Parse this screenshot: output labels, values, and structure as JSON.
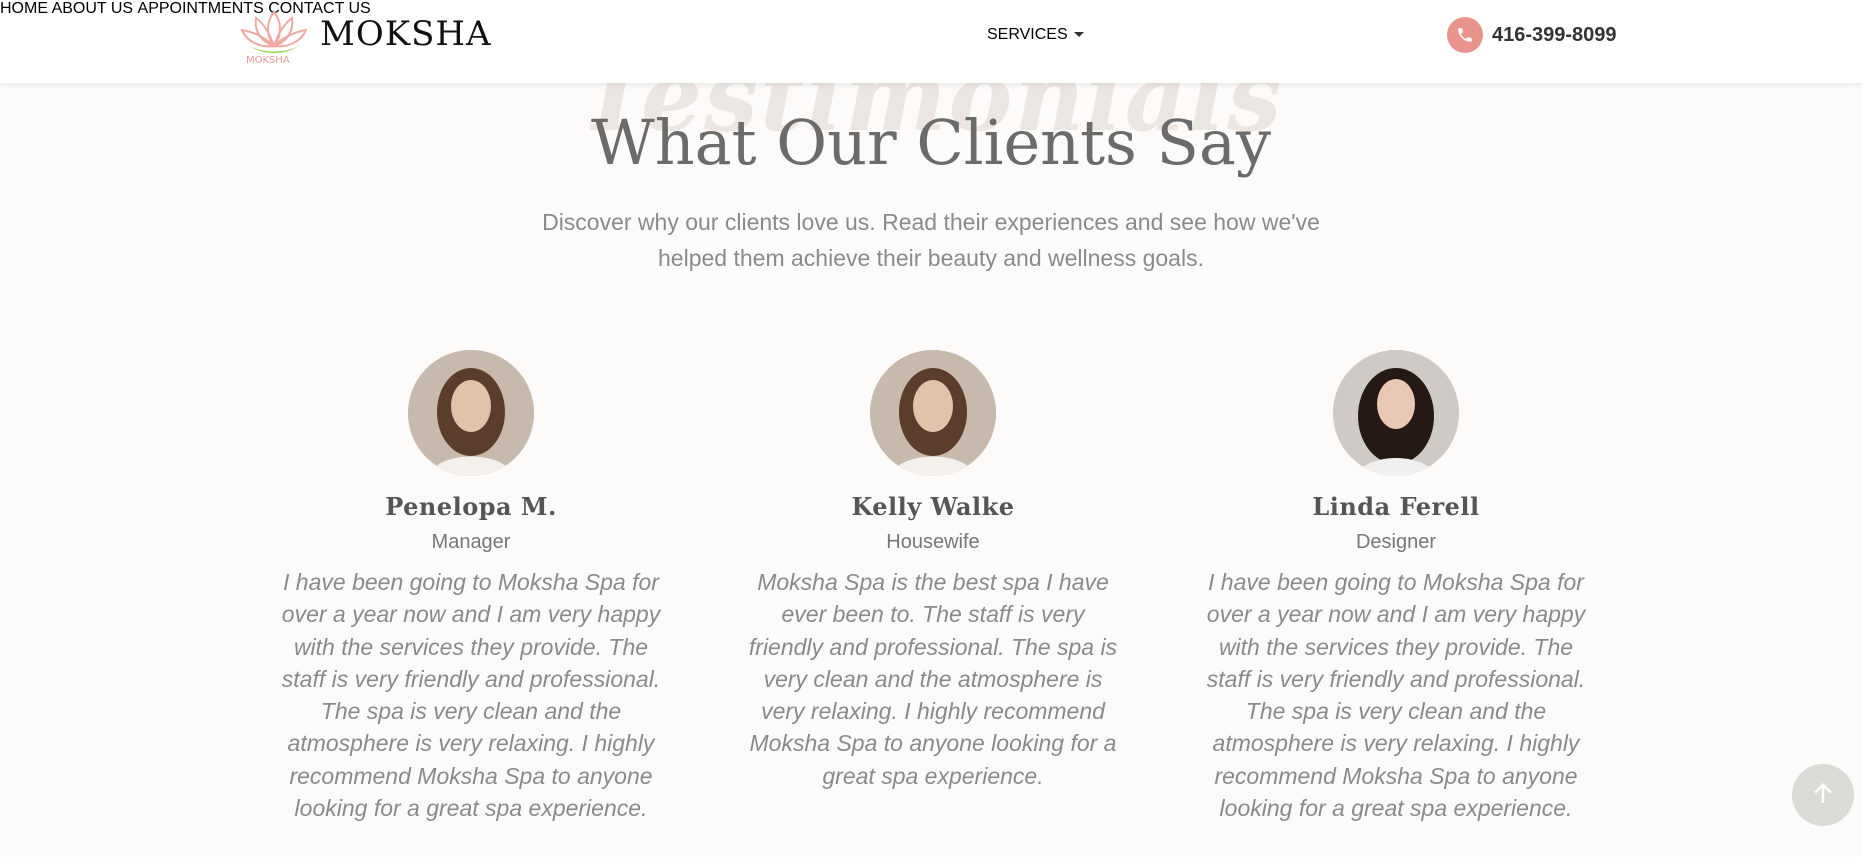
{
  "brand": {
    "name": "MOKSHA",
    "logo_caption": "MOKSHA"
  },
  "nav": {
    "items": [
      "HOME",
      "ABOUT US",
      "SERVICES",
      "APPOINTMENTS",
      "CONTACT US"
    ],
    "phone": "416-399-8099"
  },
  "section": {
    "watermark": "Testimonials",
    "title": "What Our Clients Say",
    "subtitle": "Discover why our clients love us. Read their experiences and see how we've helped them achieve their beauty and wellness goals."
  },
  "testimonials": [
    {
      "name": "Penelopa M.",
      "role": "Manager",
      "quote": "I have been going to Moksha Spa for over a year now and I am very happy with the services they provide. The staff is very friendly and professional. The spa is very clean and the atmosphere is very relaxing. I highly recommend Moksha Spa to anyone looking for a great spa experience."
    },
    {
      "name": "Kelly Walke",
      "role": "Housewife",
      "quote": "Moksha Spa is the best spa I have ever been to. The staff is very friendly and professional. The spa is very clean and the atmosphere is very relaxing. I highly recommend Moksha Spa to anyone looking for a great spa experience."
    },
    {
      "name": "Linda Ferell",
      "role": "Designer",
      "quote": "I have been going to Moksha Spa for over a year now and I am very happy with the services they provide. The staff is very friendly and professional. The spa is very clean and the atmosphere is very relaxing. I highly recommend Moksha Spa to anyone looking for a great spa experience."
    }
  ],
  "colors": {
    "accent": "#e8938c",
    "title": "#6b6b6b",
    "background": "#fcfbfa"
  },
  "icons": {
    "phone": "phone-icon",
    "scroll_top": "arrow-up-icon"
  }
}
